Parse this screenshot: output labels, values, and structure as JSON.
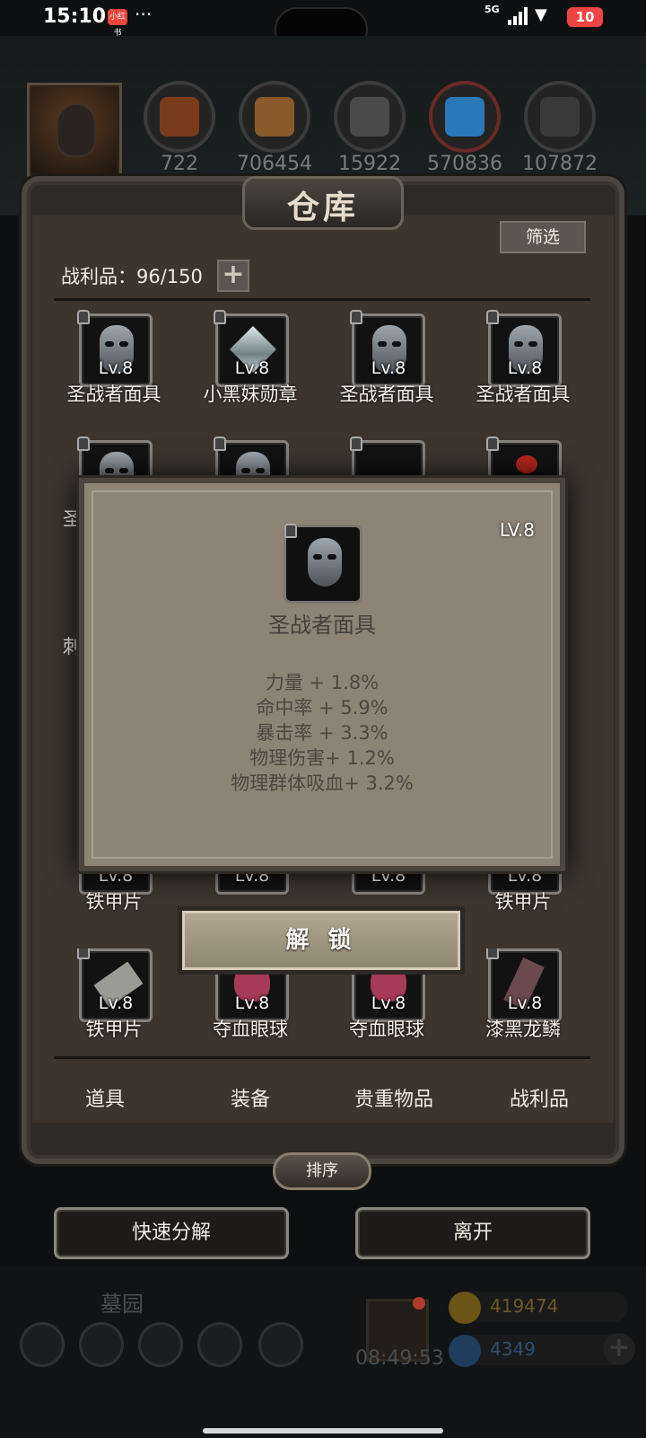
{
  "status": {
    "time": "15:10",
    "app_badge": "小红书",
    "more": "···",
    "network": "5G",
    "battery": "10"
  },
  "resources": [
    {
      "name": "wood-log",
      "value": "722",
      "color": "#7a3a1c"
    },
    {
      "name": "plank",
      "value": "706454",
      "color": "#8a5a2a"
    },
    {
      "name": "iron-ingot",
      "value": "15922",
      "color": "#4a4a4a"
    },
    {
      "name": "crystal",
      "value": "570836",
      "color": "#2a78b8"
    },
    {
      "name": "steel",
      "value": "107872",
      "color": "#3a3a3a"
    }
  ],
  "panel": {
    "title": "仓库",
    "filter": "筛选",
    "capacity": "战利品：96/150",
    "plus": "+"
  },
  "items": [
    {
      "name": "圣战者面具",
      "lv": "Lv.8",
      "icon": "mask"
    },
    {
      "name": "小黑妹勋章",
      "lv": "Lv.8",
      "icon": "gem"
    },
    {
      "name": "圣战者面具",
      "lv": "Lv.8",
      "icon": "mask"
    },
    {
      "name": "圣战者面具",
      "lv": "Lv.8",
      "icon": "mask"
    },
    {
      "name": "铁甲片",
      "lv": "Lv.8",
      "icon": "shard"
    },
    {
      "name": "",
      "lv": "Lv.8",
      "icon": "shard"
    },
    {
      "name": "",
      "lv": "Lv.8",
      "icon": "shard"
    },
    {
      "name": "铁甲片",
      "lv": "Lv.8",
      "icon": "shard"
    },
    {
      "name": "铁甲片",
      "lv": "Lv.8",
      "icon": "shard"
    },
    {
      "name": "夺血眼球",
      "lv": "Lv.8",
      "icon": "eyeball"
    },
    {
      "name": "夺血眼球",
      "lv": "Lv.8",
      "icon": "eyeball"
    },
    {
      "name": "漆黑龙鳞",
      "lv": "Lv.8",
      "icon": "scale"
    }
  ],
  "partial_left_chars": [
    "圣",
    "刺"
  ],
  "popup": {
    "lv": "LV.8",
    "name": "圣战者面具",
    "stats": [
      "力量 + 1.8%",
      "命中率 + 5.9%",
      "暴击率 + 3.3%",
      "物理伤害+ 1.2%",
      "物理群体吸血+ 3.2%"
    ],
    "unlock": "解 锁"
  },
  "tabs": [
    "道具",
    "装备",
    "贵重物品",
    "战利品"
  ],
  "sort": "排序",
  "buttons": {
    "decompose": "快速分解",
    "leave": "离开"
  },
  "bottom": {
    "area": "墓园",
    "timer": "08:49:53",
    "gold": "419474",
    "gems": "4349"
  }
}
